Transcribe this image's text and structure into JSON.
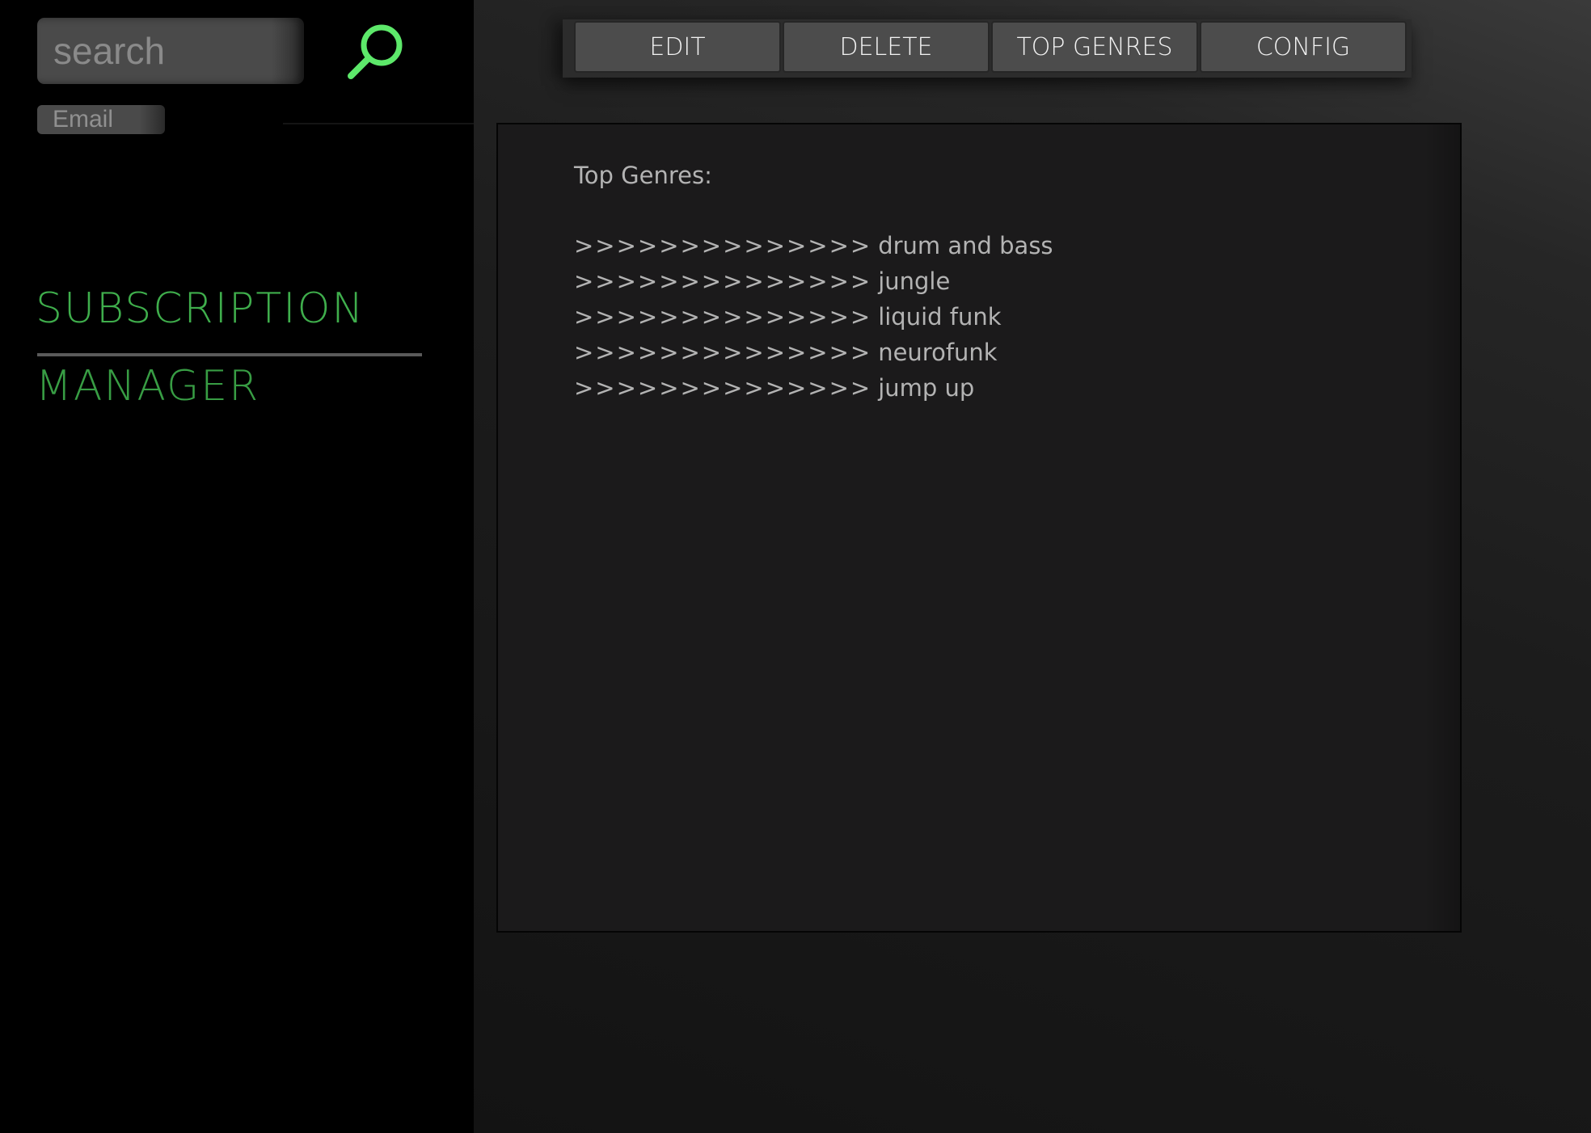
{
  "sidebar": {
    "search": {
      "placeholder": "search",
      "value": ""
    },
    "search_icon": "search-icon",
    "email": {
      "placeholder": "Email",
      "value": ""
    },
    "brand": {
      "line1": "SUBSCRIPTION",
      "line2": "MANAGER"
    }
  },
  "toolbar": {
    "buttons": [
      {
        "label": "EDIT"
      },
      {
        "label": "DELETE"
      },
      {
        "label": "TOP GENRES"
      },
      {
        "label": "CONFIG"
      }
    ]
  },
  "panel": {
    "heading": "Top Genres:",
    "genres": [
      {
        "prefix": ">>>>>>>>>>>>>>",
        "name": "drum and bass"
      },
      {
        "prefix": ">>>>>>>>>>>>>>",
        "name": "jungle"
      },
      {
        "prefix": ">>>>>>>>>>>>>>",
        "name": "liquid funk"
      },
      {
        "prefix": ">>>>>>>>>>>>>>",
        "name": "neurofunk"
      },
      {
        "prefix": ">>>>>>>>>>>>>>",
        "name": "jump up"
      }
    ]
  },
  "colors": {
    "accent": "#3fae4c",
    "search_icon": "#5de86a",
    "sidebar_bg": "#000000",
    "panel_bg": "#1b1a1b",
    "button_bg": "#4c4c4c"
  }
}
